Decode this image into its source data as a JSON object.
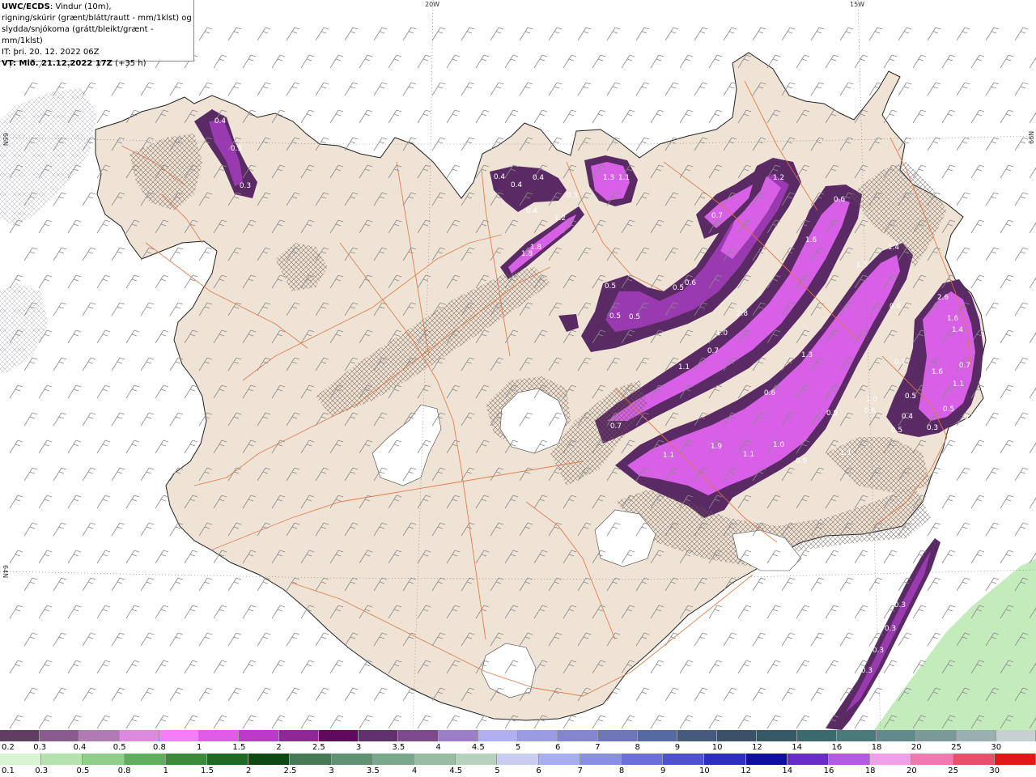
{
  "header": {
    "model": "UWC/ECDS",
    "line1": ": Vindur (10m),",
    "line2": "rigning/skúrir (grænt/blátt/rautt - mm/1klst) og",
    "line3": "slydda/snjókoma (grátt/bleikt/grænt - mm/1klst)",
    "issue_time": "IT: þri. 20. 12. 2022 06Z",
    "valid_time": "VT: Mið. 21.12.2022 17Z",
    "lead_time": "(+35 h)"
  },
  "grid_labels": {
    "lon_20w": "20W",
    "lon_15w": "15W",
    "lat_66n_left": "66N",
    "lat_66n_right": "66N",
    "lat_64n_left": "64N"
  },
  "colors": {
    "land": "#efe3d6",
    "sea": "#ffffff",
    "roads": "#e2753f",
    "coast": "#222222",
    "wind_barbs": "#8a8a8a",
    "snow_dark": "#5a2a64",
    "snow_mid": "#9a3ab0",
    "snow_light": "#d760e6",
    "rain_green": "#b9e7b0"
  },
  "precip_labels": [
    "0.4",
    "0.3",
    "0.3",
    "0.4",
    "0.4",
    "0.4",
    "0.4",
    "1.2",
    "1.8",
    "1.8",
    "1.3",
    "1.1",
    "0.3",
    "1.2",
    "0.7",
    "0.5",
    "0.5",
    "0.6",
    "0.5",
    "0.5",
    "0.6",
    "1.6",
    "1.4",
    "1.5",
    "2.8",
    "1.0",
    "0.7",
    "1.1",
    "1.3",
    "0.6",
    "2.6",
    "0.7",
    "1.6",
    "1.4",
    "1.6",
    "0.7",
    "1.1",
    "1.0",
    "0.5",
    "0.5",
    "0.6",
    "0.5",
    "0.4",
    "0.3",
    "0.5",
    "0.6",
    "0.9",
    "0.3",
    "0.7",
    "1.9",
    "1.1",
    "1.1",
    "1.0",
    "0.9",
    "1.1",
    "0.3",
    "0.3",
    "0.3",
    "0.3"
  ],
  "legend_snow": {
    "values": [
      "0.2",
      "0.3",
      "0.4",
      "0.5",
      "0.8",
      "1",
      "1.5",
      "2",
      "2.5",
      "3",
      "3.5",
      "4",
      "4.5",
      "5",
      "6",
      "7",
      "8",
      "9",
      "10",
      "12",
      "14",
      "16",
      "18",
      "20",
      "25",
      "30"
    ],
    "colors": [
      "#5e3f62",
      "#8a5b8e",
      "#b27ab5",
      "#dc8ae0",
      "#f57ef8",
      "#e05be8",
      "#bb3ac8",
      "#8f2896",
      "#5f0a5e",
      "#60306f",
      "#7c4a8c",
      "#9b7ec5",
      "#b0b0f0",
      "#9b9be3",
      "#8585cf",
      "#6d77b8",
      "#546aa0",
      "#445b7e",
      "#3b5168",
      "#355a66",
      "#3b6a6e",
      "#4b7a7a",
      "#628a8a",
      "#7a9a9a",
      "#9ab0b0",
      "#c6d0d0"
    ]
  },
  "legend_rain": {
    "values": [
      "0.1",
      "0.3",
      "0.5",
      "0.8",
      "1",
      "1.5",
      "2",
      "2.5",
      "3",
      "3.5",
      "4",
      "4.5",
      "5",
      "6",
      "7",
      "8",
      "9",
      "10",
      "12",
      "14",
      "16",
      "18",
      "20",
      "25",
      "30"
    ],
    "colors": [
      "#d6f5d0",
      "#b4e3ad",
      "#8fcf8a",
      "#5fae5d",
      "#3b8a3a",
      "#1e6a22",
      "#0d4a12",
      "#457a55",
      "#5e9270",
      "#7aa88a",
      "#97bea3",
      "#b5d3bc",
      "#c9cdf0",
      "#a7aef0",
      "#8a8fe6",
      "#6b6fdc",
      "#4f52cf",
      "#2d2fc1",
      "#1010a0",
      "#6a2cc6",
      "#b25ae0",
      "#f0a0e8",
      "#f07ab0",
      "#e8506a",
      "#e01818"
    ]
  }
}
